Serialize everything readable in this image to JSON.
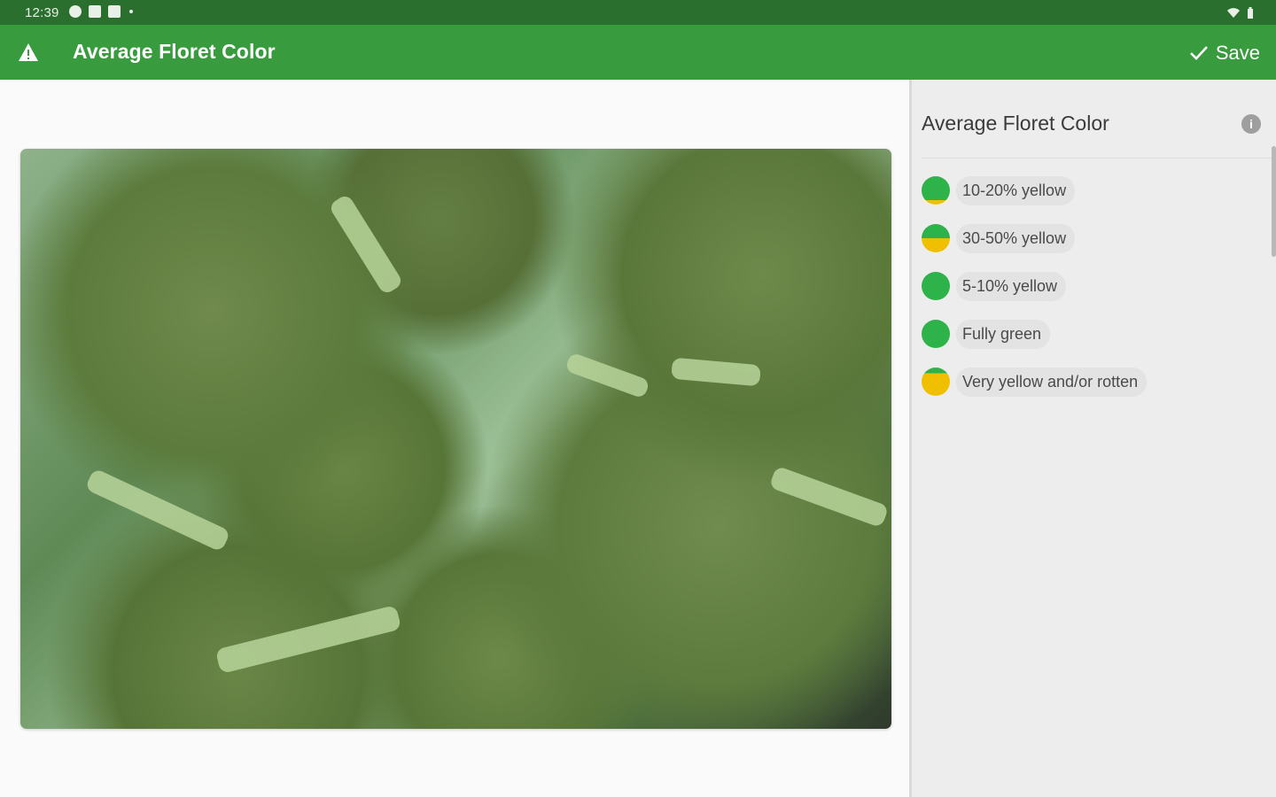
{
  "status_bar": {
    "time": "12:39",
    "icons": [
      "sync-icon",
      "image-icon",
      "screenshot-icon",
      "dot-icon",
      "wifi-icon",
      "battery-icon"
    ]
  },
  "app_bar": {
    "title": "Average Floret Color",
    "save_label": "Save",
    "color": "#389b3d"
  },
  "panel": {
    "title": "Average Floret Color",
    "info_label": "i",
    "options": [
      {
        "label": "10-20% yellow",
        "swatch": "mostly-green"
      },
      {
        "label": "30-50% yellow",
        "swatch": "half"
      },
      {
        "label": "5-10% yellow",
        "swatch": "green"
      },
      {
        "label": "Fully green",
        "swatch": "green"
      },
      {
        "label": "Very yellow and/or rotten",
        "swatch": "mostly-yellow"
      }
    ]
  },
  "colors": {
    "green": "#2eb24a",
    "yellow": "#f0c000",
    "status_bar": "#2b6f2e"
  }
}
